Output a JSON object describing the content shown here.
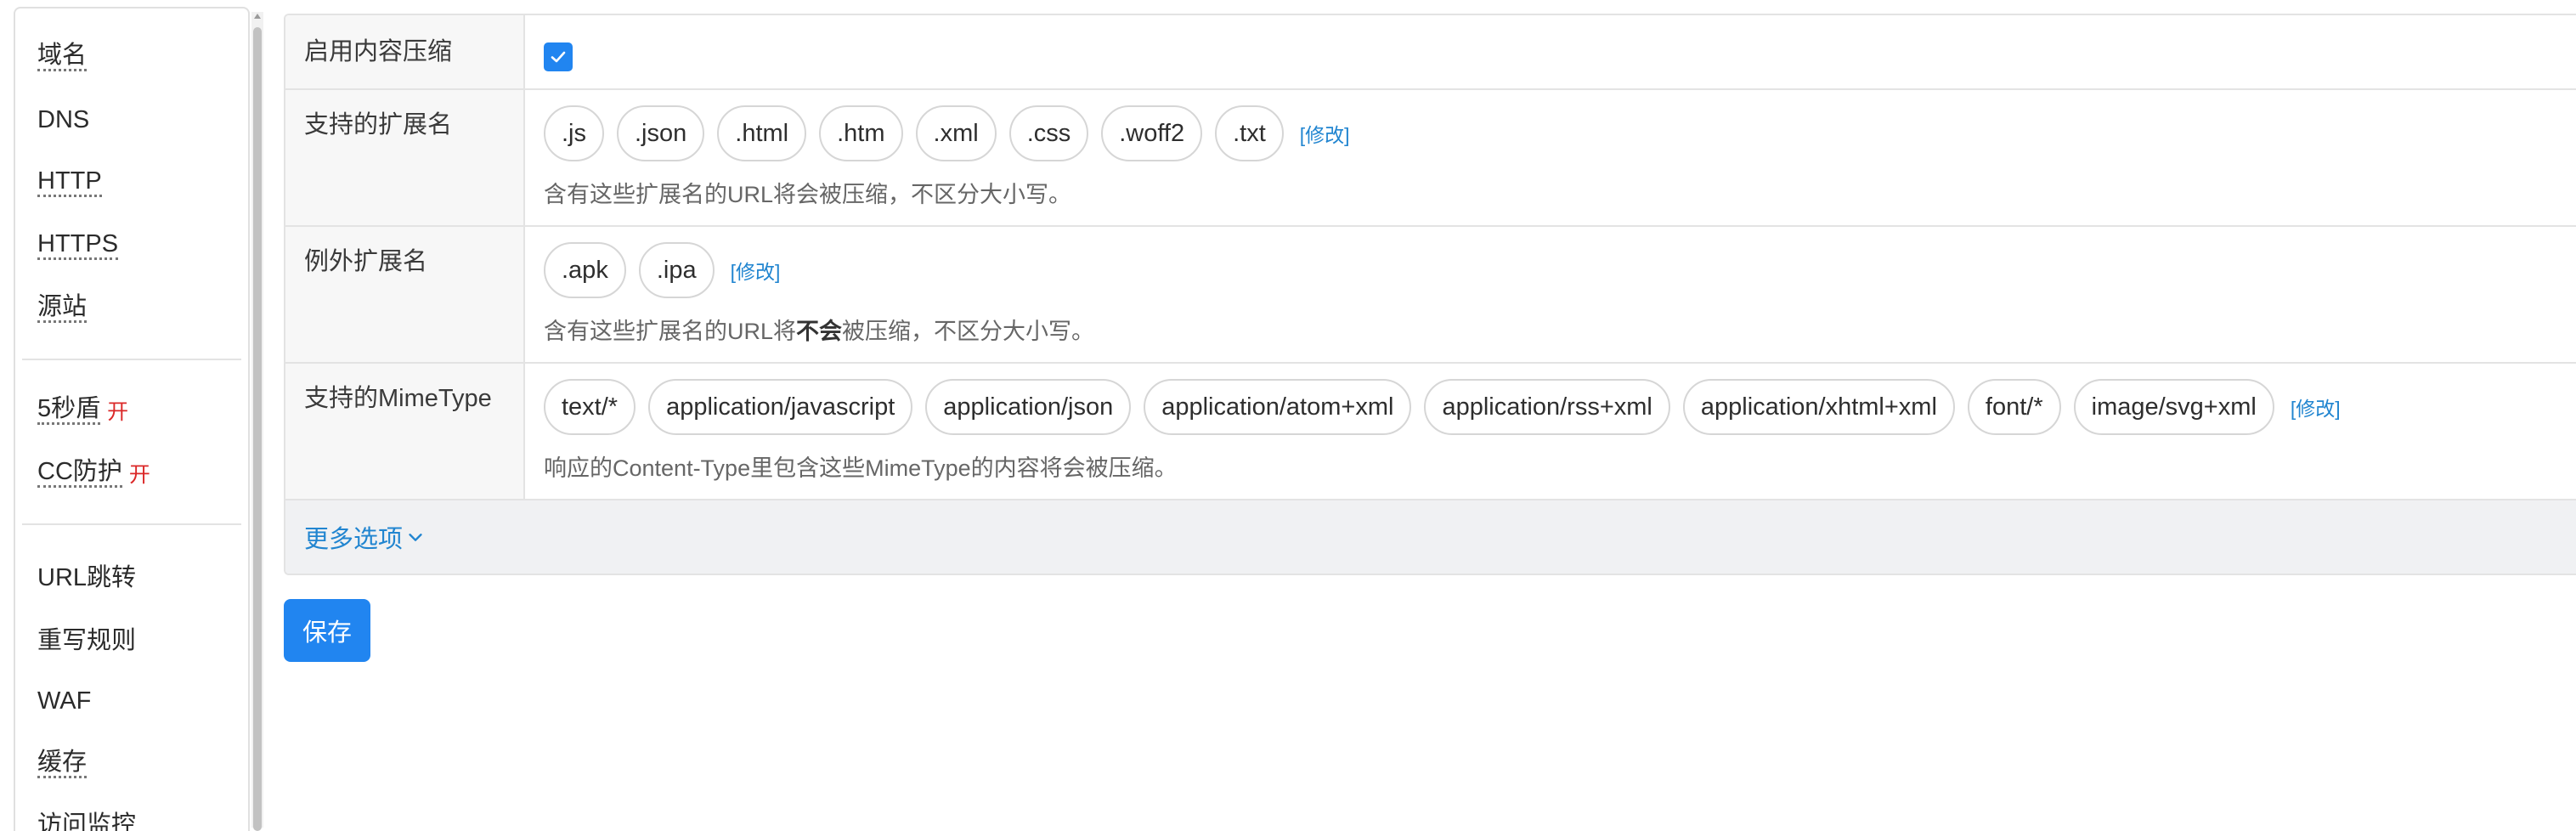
{
  "sidebar": {
    "items": [
      {
        "label": "域名",
        "dotted": true
      },
      {
        "label": "DNS",
        "dotted": false
      },
      {
        "label": "HTTP",
        "dotted": true
      },
      {
        "label": "HTTPS",
        "dotted": true
      },
      {
        "label": "源站",
        "dotted": true
      },
      {
        "label": "5秒盾",
        "dotted": true,
        "badge": "开"
      },
      {
        "label": "CC防护",
        "dotted": true,
        "badge": "开"
      },
      {
        "label": "URL跳转",
        "dotted": false
      },
      {
        "label": "重写规则",
        "dotted": false
      },
      {
        "label": "WAF",
        "dotted": false
      },
      {
        "label": "缓存",
        "dotted": true
      },
      {
        "label": "访问监控",
        "dotted": true
      }
    ]
  },
  "form": {
    "compress": {
      "label": "启用内容压缩",
      "checked": true
    },
    "extensions": {
      "label": "支持的扩展名",
      "tags": [
        ".js",
        ".json",
        ".html",
        ".htm",
        ".xml",
        ".css",
        ".woff2",
        ".txt"
      ],
      "modify": "[修改]",
      "comment": "含有这些扩展名的URL将会被压缩，不区分大小写。"
    },
    "except_extensions": {
      "label": "例外扩展名",
      "tags": [
        ".apk",
        ".ipa"
      ],
      "modify": "[修改]",
      "comment_before": "含有这些扩展名的URL将",
      "comment_bold": "不会",
      "comment_after": "被压缩，不区分大小写。"
    },
    "mimetypes": {
      "label": "支持的MimeType",
      "tags": [
        "text/*",
        "application/javascript",
        "application/json",
        "application/atom+xml",
        "application/rss+xml",
        "application/xhtml+xml",
        "font/*",
        "image/svg+xml"
      ],
      "modify": "[修改]",
      "comment": "响应的Content-Type里包含这些MimeType的内容将会被压缩。"
    },
    "more_options": "更多选项",
    "save": "保存"
  },
  "colors": {
    "accent": "#2185f0",
    "link": "#2185d0",
    "badge_on": "#db2828"
  }
}
